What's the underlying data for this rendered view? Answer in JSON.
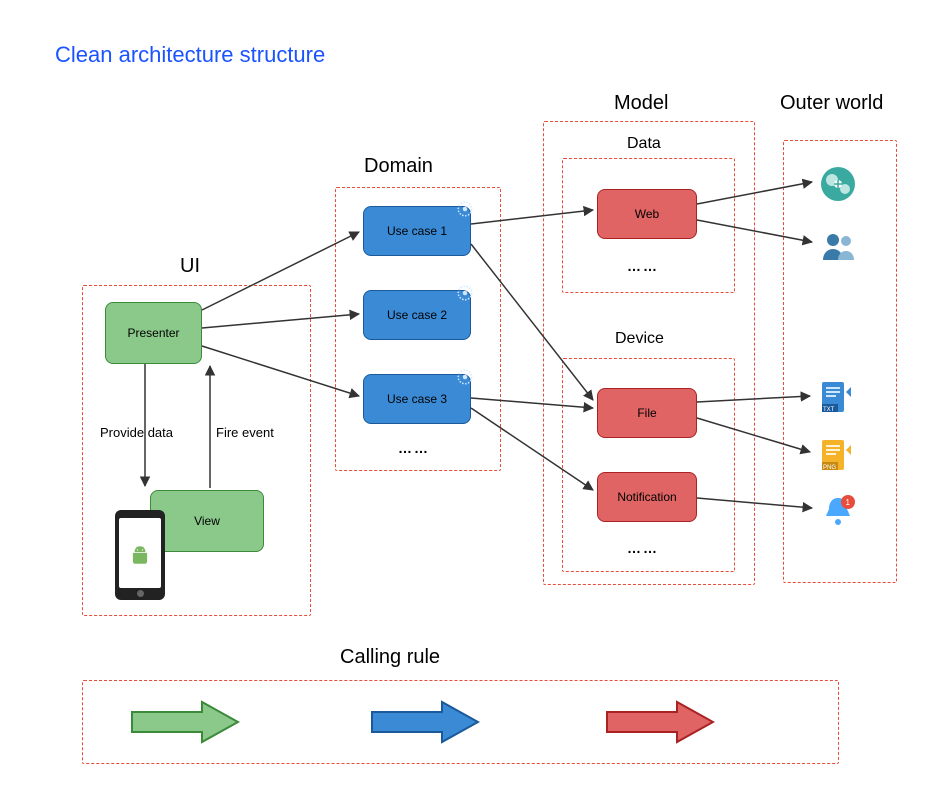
{
  "title": "Clean architecture structure",
  "layers": {
    "ui": {
      "label": "UI",
      "presenter": "Presenter",
      "view": "View",
      "edge_down": "Provide data",
      "edge_up": "Fire event"
    },
    "domain": {
      "label": "Domain",
      "usecases": [
        "Use case 1",
        "Use case 2",
        "Use case 3"
      ],
      "more": "……"
    },
    "model": {
      "label": "Model",
      "data": {
        "label": "Data",
        "items": [
          "Web"
        ],
        "more": "……"
      },
      "device": {
        "label": "Device",
        "items": [
          "File",
          "Notification"
        ],
        "more": "……"
      }
    },
    "outer": {
      "label": "Outer world"
    }
  },
  "calling_rule": {
    "label": "Calling rule"
  },
  "colors": {
    "green": "#8bc98b",
    "green_stroke": "#3a8a3a",
    "blue": "#3a8ad6",
    "blue_stroke": "#1a5a9a",
    "red": "#e06464",
    "red_stroke": "#aa2222",
    "dash": "#e74c3c",
    "title": "#1a53ff"
  },
  "outer_icons": [
    "globe",
    "people",
    "file-txt",
    "file-png",
    "bell-badge"
  ]
}
